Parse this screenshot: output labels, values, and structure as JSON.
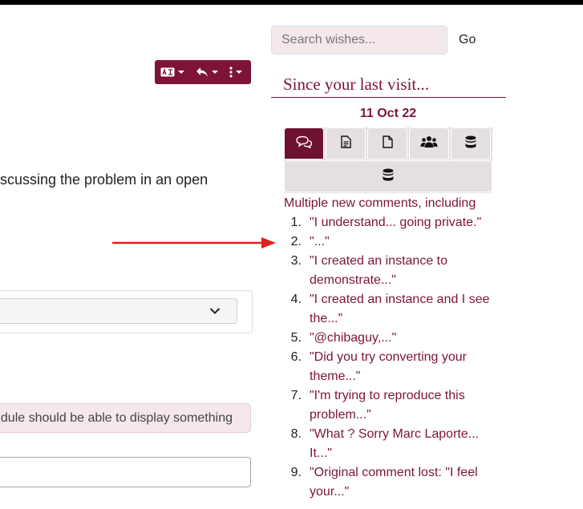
{
  "main": {
    "body_text": "scussing the problem in an open",
    "alert_text": "dule should be able to display something"
  },
  "sidebar": {
    "search_placeholder": "Search wishes...",
    "go_label": "Go",
    "since_heading": "Since your last visit...",
    "date": "11 Oct 22",
    "summary": "Multiple new comments, including",
    "comments": [
      {
        "num": "1.",
        "text": "\"I understand... going private.\""
      },
      {
        "num": "2.",
        "text": "\"...\""
      },
      {
        "num": "3.",
        "text": "\"I created an instance to demonstrate...\""
      },
      {
        "num": "4.",
        "text": "\"I created an instance and I see the...\""
      },
      {
        "num": "5.",
        "text": "\"@chibaguy,...\""
      },
      {
        "num": "6.",
        "text": "\"Did you try converting your theme...\""
      },
      {
        "num": "7.",
        "text": "\"I'm trying to reproduce this problem...\""
      },
      {
        "num": "8.",
        "text": "\"What ? Sorry Marc Laporte... It...\""
      },
      {
        "num": "9.",
        "text": "\"Original comment lost: \"I feel your...\""
      }
    ]
  },
  "colors": {
    "accent": "#7d1438",
    "tab_active": "#6d1230",
    "alert_bg": "#f4e8ea",
    "arrow": "#e02020"
  },
  "icons": {
    "toolbar": [
      "translate-icon",
      "reply-icon",
      "more-vertical-icon"
    ],
    "tabs": [
      "comments-icon",
      "document-text-icon",
      "file-icon",
      "users-icon",
      "database-icon",
      "database-icon"
    ]
  }
}
